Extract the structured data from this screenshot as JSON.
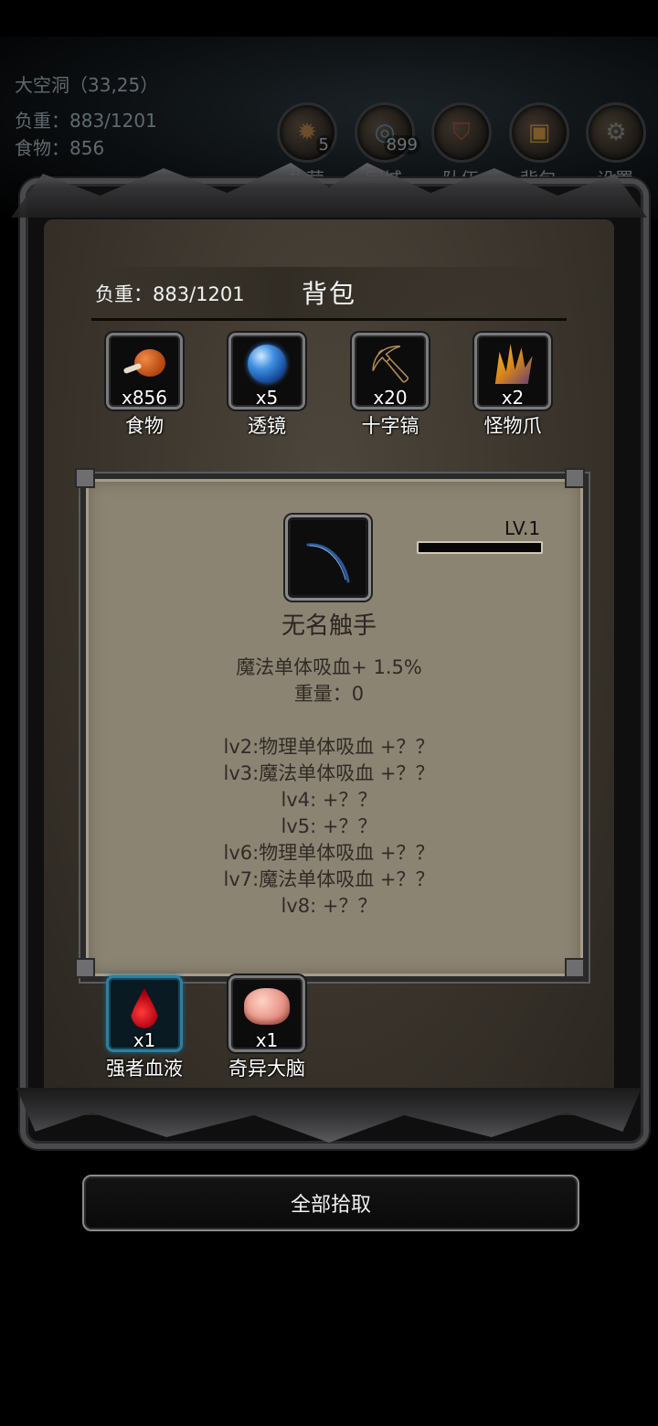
{
  "hud": {
    "location": "大空洞（33,25）",
    "weight": "负重：883/1201",
    "food": "食物：856"
  },
  "top_buttons": [
    {
      "label": "扎营",
      "badge": "5",
      "icon": "campfire-icon"
    },
    {
      "label": "回城",
      "badge": "899",
      "icon": "portal-icon"
    },
    {
      "label": "队伍",
      "badge": "",
      "icon": "shield-icon"
    },
    {
      "label": "背包",
      "badge": "",
      "icon": "backpack-icon"
    },
    {
      "label": "设置",
      "badge": "",
      "icon": "gear-icon"
    }
  ],
  "panel": {
    "weight": "负重：883/1201",
    "title": "背包"
  },
  "items_top": [
    {
      "name": "食物",
      "count": "x856",
      "icon": "meat-icon"
    },
    {
      "name": "透镜",
      "count": "x5",
      "icon": "lens-icon"
    },
    {
      "name": "十字镐",
      "count": "x20",
      "icon": "pickaxe-icon"
    },
    {
      "name": "怪物爪",
      "count": "x2",
      "icon": "claw-icon"
    }
  ],
  "detail": {
    "level": "LV.1",
    "level_progress": 0,
    "name": "无名触手",
    "icon": "tentacle-icon",
    "lines": [
      "魔法单体吸血+ 1.5%",
      "重量：0",
      "",
      "lv2:物理单体吸血 +？？",
      "lv3:魔法单体吸血 +？？",
      "lv4: +？？",
      "lv5: +？？",
      "lv6:物理单体吸血 +？？",
      "lv7:魔法单体吸血 +？？",
      "lv8: +？？"
    ]
  },
  "items_bottom": [
    {
      "name": "强者血液",
      "count": "x1",
      "icon": "blood-drop-icon"
    },
    {
      "name": "奇异大脑",
      "count": "x1",
      "icon": "brain-icon"
    }
  ],
  "pick_all_label": "全部拾取"
}
